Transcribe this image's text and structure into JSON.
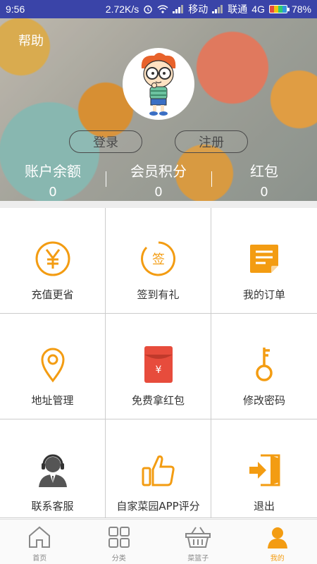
{
  "status_bar": {
    "time": "9:56",
    "speed": "2.72K/s",
    "carrier1": "移动",
    "carrier2": "联通",
    "network": "4G",
    "battery": "78%"
  },
  "header": {
    "help": "帮助",
    "login": "登录",
    "register": "注册",
    "stats": [
      {
        "label": "账户余额",
        "value": "0"
      },
      {
        "label": "会员积分",
        "value": "0"
      },
      {
        "label": "红包",
        "value": "0"
      }
    ]
  },
  "menu": [
    {
      "label": "充值更省",
      "icon": "yuan-coin-icon"
    },
    {
      "label": "签到有礼",
      "icon": "sign-in-icon"
    },
    {
      "label": "我的订单",
      "icon": "order-list-icon"
    },
    {
      "label": "地址管理",
      "icon": "location-pin-icon"
    },
    {
      "label": "免费拿红包",
      "icon": "red-envelope-icon"
    },
    {
      "label": "修改密码",
      "icon": "key-icon"
    },
    {
      "label": "联系客服",
      "icon": "customer-service-icon"
    },
    {
      "label": "自家菜园APP评分",
      "icon": "thumbs-up-icon"
    },
    {
      "label": "退出",
      "icon": "logout-icon"
    }
  ],
  "tabs": [
    {
      "label": "首页",
      "icon": "home-icon"
    },
    {
      "label": "分类",
      "icon": "category-grid-icon"
    },
    {
      "label": "菜篮子",
      "icon": "basket-icon"
    },
    {
      "label": "我的",
      "icon": "user-icon",
      "active": true
    }
  ],
  "colors": {
    "accent": "#f39c12",
    "status_bar": "#3a44a8",
    "red_envelope": "#e74c3c"
  }
}
